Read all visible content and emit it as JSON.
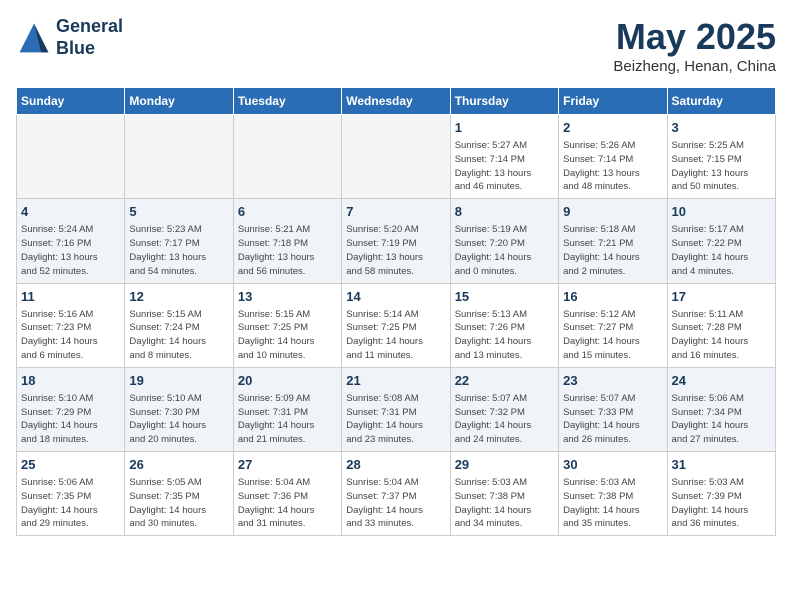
{
  "header": {
    "logo_line1": "General",
    "logo_line2": "Blue",
    "month": "May 2025",
    "location": "Beizheng, Henan, China"
  },
  "weekdays": [
    "Sunday",
    "Monday",
    "Tuesday",
    "Wednesday",
    "Thursday",
    "Friday",
    "Saturday"
  ],
  "weeks": [
    [
      {
        "day": "",
        "info": ""
      },
      {
        "day": "",
        "info": ""
      },
      {
        "day": "",
        "info": ""
      },
      {
        "day": "",
        "info": ""
      },
      {
        "day": "1",
        "info": "Sunrise: 5:27 AM\nSunset: 7:14 PM\nDaylight: 13 hours\nand 46 minutes."
      },
      {
        "day": "2",
        "info": "Sunrise: 5:26 AM\nSunset: 7:14 PM\nDaylight: 13 hours\nand 48 minutes."
      },
      {
        "day": "3",
        "info": "Sunrise: 5:25 AM\nSunset: 7:15 PM\nDaylight: 13 hours\nand 50 minutes."
      }
    ],
    [
      {
        "day": "4",
        "info": "Sunrise: 5:24 AM\nSunset: 7:16 PM\nDaylight: 13 hours\nand 52 minutes."
      },
      {
        "day": "5",
        "info": "Sunrise: 5:23 AM\nSunset: 7:17 PM\nDaylight: 13 hours\nand 54 minutes."
      },
      {
        "day": "6",
        "info": "Sunrise: 5:21 AM\nSunset: 7:18 PM\nDaylight: 13 hours\nand 56 minutes."
      },
      {
        "day": "7",
        "info": "Sunrise: 5:20 AM\nSunset: 7:19 PM\nDaylight: 13 hours\nand 58 minutes."
      },
      {
        "day": "8",
        "info": "Sunrise: 5:19 AM\nSunset: 7:20 PM\nDaylight: 14 hours\nand 0 minutes."
      },
      {
        "day": "9",
        "info": "Sunrise: 5:18 AM\nSunset: 7:21 PM\nDaylight: 14 hours\nand 2 minutes."
      },
      {
        "day": "10",
        "info": "Sunrise: 5:17 AM\nSunset: 7:22 PM\nDaylight: 14 hours\nand 4 minutes."
      }
    ],
    [
      {
        "day": "11",
        "info": "Sunrise: 5:16 AM\nSunset: 7:23 PM\nDaylight: 14 hours\nand 6 minutes."
      },
      {
        "day": "12",
        "info": "Sunrise: 5:15 AM\nSunset: 7:24 PM\nDaylight: 14 hours\nand 8 minutes."
      },
      {
        "day": "13",
        "info": "Sunrise: 5:15 AM\nSunset: 7:25 PM\nDaylight: 14 hours\nand 10 minutes."
      },
      {
        "day": "14",
        "info": "Sunrise: 5:14 AM\nSunset: 7:25 PM\nDaylight: 14 hours\nand 11 minutes."
      },
      {
        "day": "15",
        "info": "Sunrise: 5:13 AM\nSunset: 7:26 PM\nDaylight: 14 hours\nand 13 minutes."
      },
      {
        "day": "16",
        "info": "Sunrise: 5:12 AM\nSunset: 7:27 PM\nDaylight: 14 hours\nand 15 minutes."
      },
      {
        "day": "17",
        "info": "Sunrise: 5:11 AM\nSunset: 7:28 PM\nDaylight: 14 hours\nand 16 minutes."
      }
    ],
    [
      {
        "day": "18",
        "info": "Sunrise: 5:10 AM\nSunset: 7:29 PM\nDaylight: 14 hours\nand 18 minutes."
      },
      {
        "day": "19",
        "info": "Sunrise: 5:10 AM\nSunset: 7:30 PM\nDaylight: 14 hours\nand 20 minutes."
      },
      {
        "day": "20",
        "info": "Sunrise: 5:09 AM\nSunset: 7:31 PM\nDaylight: 14 hours\nand 21 minutes."
      },
      {
        "day": "21",
        "info": "Sunrise: 5:08 AM\nSunset: 7:31 PM\nDaylight: 14 hours\nand 23 minutes."
      },
      {
        "day": "22",
        "info": "Sunrise: 5:07 AM\nSunset: 7:32 PM\nDaylight: 14 hours\nand 24 minutes."
      },
      {
        "day": "23",
        "info": "Sunrise: 5:07 AM\nSunset: 7:33 PM\nDaylight: 14 hours\nand 26 minutes."
      },
      {
        "day": "24",
        "info": "Sunrise: 5:06 AM\nSunset: 7:34 PM\nDaylight: 14 hours\nand 27 minutes."
      }
    ],
    [
      {
        "day": "25",
        "info": "Sunrise: 5:06 AM\nSunset: 7:35 PM\nDaylight: 14 hours\nand 29 minutes."
      },
      {
        "day": "26",
        "info": "Sunrise: 5:05 AM\nSunset: 7:35 PM\nDaylight: 14 hours\nand 30 minutes."
      },
      {
        "day": "27",
        "info": "Sunrise: 5:04 AM\nSunset: 7:36 PM\nDaylight: 14 hours\nand 31 minutes."
      },
      {
        "day": "28",
        "info": "Sunrise: 5:04 AM\nSunset: 7:37 PM\nDaylight: 14 hours\nand 33 minutes."
      },
      {
        "day": "29",
        "info": "Sunrise: 5:03 AM\nSunset: 7:38 PM\nDaylight: 14 hours\nand 34 minutes."
      },
      {
        "day": "30",
        "info": "Sunrise: 5:03 AM\nSunset: 7:38 PM\nDaylight: 14 hours\nand 35 minutes."
      },
      {
        "day": "31",
        "info": "Sunrise: 5:03 AM\nSunset: 7:39 PM\nDaylight: 14 hours\nand 36 minutes."
      }
    ]
  ]
}
